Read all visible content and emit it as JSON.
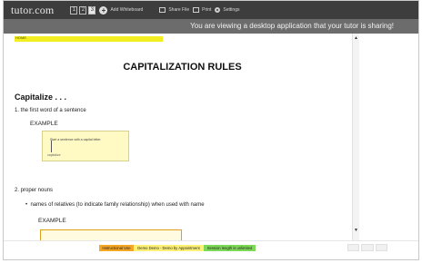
{
  "app": {
    "logo": "tutor.com"
  },
  "toolbar": {
    "pages": [
      "1",
      "2",
      "3"
    ],
    "active_page": "3",
    "add_whiteboard": "Add Whiteboard",
    "share_file": "Share File",
    "print": "Print",
    "settings": "Settings"
  },
  "share_banner": "You are viewing a desktop application that your tutor is sharing!",
  "doc": {
    "home": "HOME",
    "title": "CAPITALIZATION RULES",
    "capitalize": "Capitalize . . .",
    "rule1": "1.  the first word of a sentence",
    "example1": "EXAMPLE",
    "example1_sentence": "Start a sentence with a capital letter.",
    "example1_caption": "capitalize",
    "rule2": "2.  proper nouns",
    "bullet1": "names of relatives (to indicate family relationship) when used with name",
    "example2": "EXAMPLE"
  },
  "scroll": {
    "up_icon": "▲",
    "down_icon": "▼"
  },
  "footer": {
    "seg1": "Instructional Use",
    "seg2": "Demo Demo - Demo by Appointment",
    "seg3": "Session length is unlimited"
  },
  "colors": {
    "topbar": "#3d3d3d",
    "banner": "#6c6c6c",
    "highlight": "#f2ee1f"
  }
}
